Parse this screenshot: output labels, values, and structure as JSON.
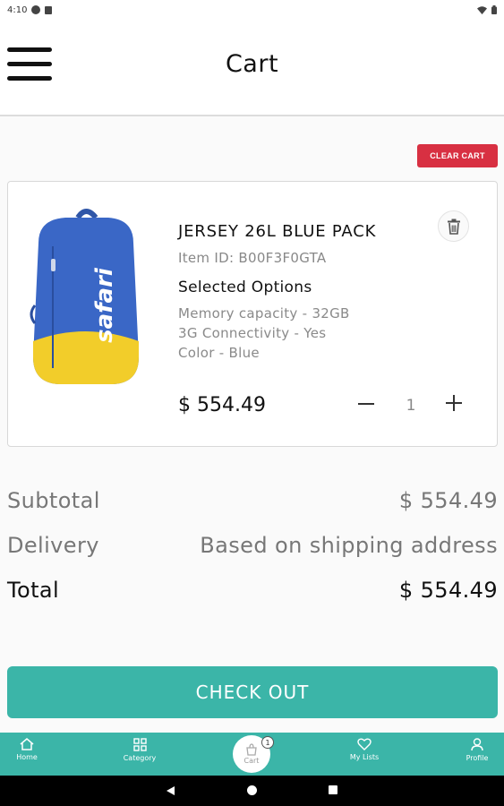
{
  "status_bar": {
    "time": "4:10"
  },
  "header": {
    "title": "Cart"
  },
  "clear_cart_label": "CLEAR CART",
  "cart_item": {
    "name": "JERSEY 26L BLUE PACK",
    "item_id": "Item ID: B00F3F0GTA",
    "options_heading": "Selected Options",
    "options": [
      "Memory capacity - 32GB",
      "3G Connectivity - Yes",
      "Color - Blue"
    ],
    "price": "$ 554.49",
    "quantity": "1",
    "image_brand_text": "safari"
  },
  "summary": {
    "subtotal_label": "Subtotal",
    "subtotal_value": "$ 554.49",
    "delivery_label": "Delivery",
    "delivery_value": "Based on shipping address",
    "total_label": "Total",
    "total_value": "$ 554.49"
  },
  "checkout_label": "CHECK OUT",
  "bottom_nav": {
    "home": "Home",
    "category": "Category",
    "cart": "Cart",
    "cart_count": "1",
    "lists": "My Lists",
    "profile": "Profile"
  },
  "colors": {
    "accent": "#3bb5a8",
    "clear_cart": "#d83042"
  },
  "icons": [
    "menu-icon",
    "trash-icon",
    "minus-icon",
    "plus-icon",
    "home-icon",
    "category-icon",
    "cart-icon",
    "heart-icon",
    "profile-icon",
    "wifi-icon",
    "battery-icon"
  ]
}
